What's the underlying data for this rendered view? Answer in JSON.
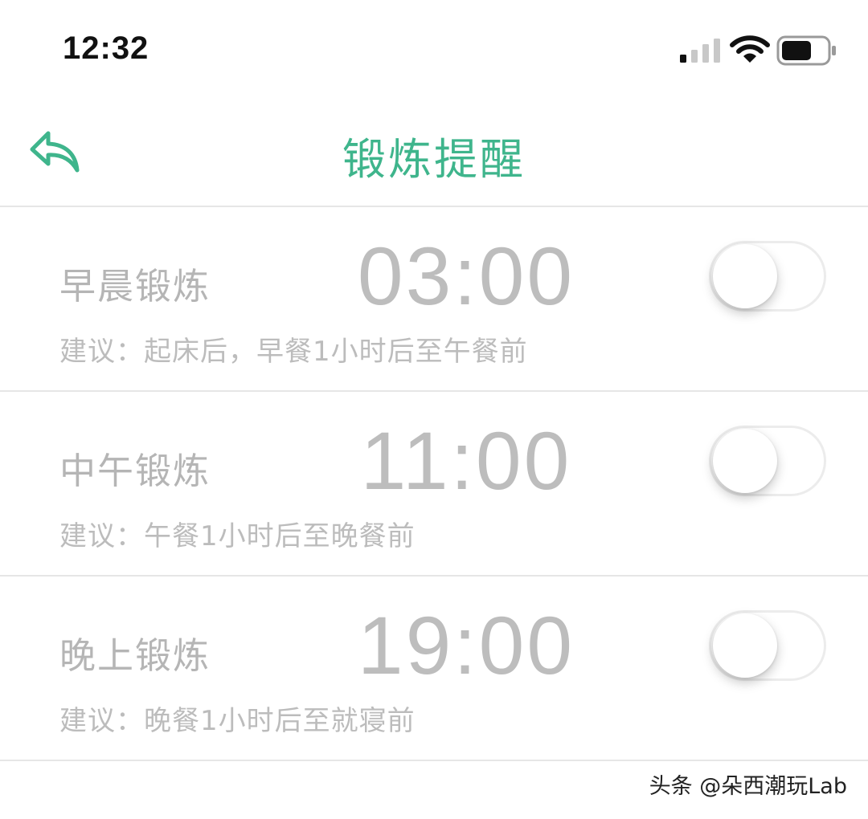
{
  "status_bar": {
    "time": "12:32",
    "icons": [
      "cellular-signal-icon",
      "wifi-icon",
      "battery-icon"
    ],
    "battery_level": 0.6
  },
  "nav": {
    "back_icon": "back-arrow-icon",
    "title": "锻炼提醒",
    "accent_color": "#3fb58c"
  },
  "reminders": [
    {
      "label": "早晨锻炼",
      "time": "03:00",
      "hint": "建议：起床后，早餐1小时后至午餐前",
      "enabled": false
    },
    {
      "label": "中午锻炼",
      "time": "11:00",
      "hint": "建议：午餐1小时后至晚餐前",
      "enabled": false
    },
    {
      "label": "晚上锻炼",
      "time": "19:00",
      "hint": "建议：晚餐1小时后至就寝前",
      "enabled": false
    }
  ],
  "watermark": "头条 @朵西潮玩Lab"
}
